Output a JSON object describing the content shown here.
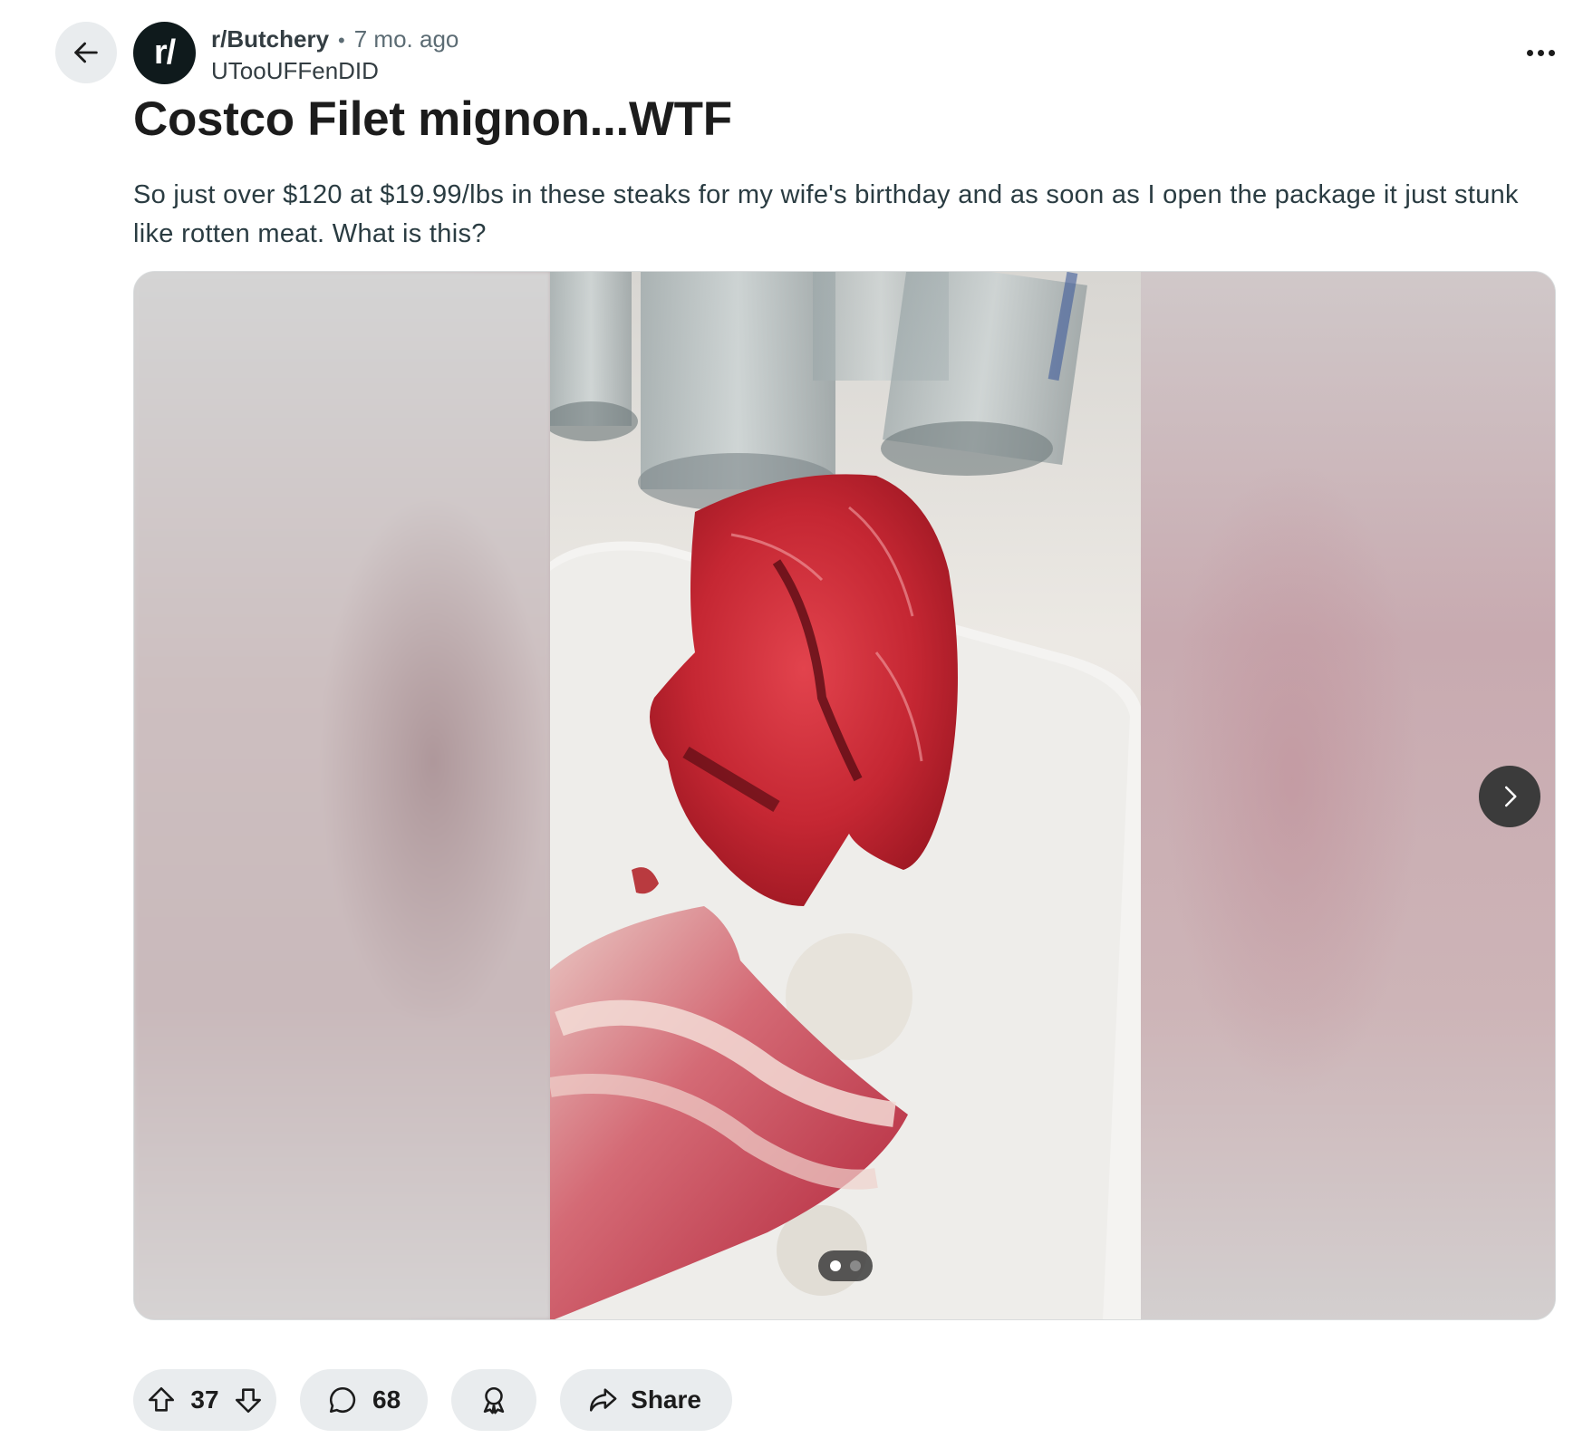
{
  "post": {
    "subreddit": "r/Butchery",
    "subreddit_avatar_text": "r/",
    "separator": "•",
    "time": "7 mo. ago",
    "author": "UTooUFFenDID",
    "title": "Costco Filet mignon...WTF",
    "body": "So just over $120 at $19.99/lbs in these steaks for my wife's birthday and as soon as I open the package it just stunk like rotten meat. What is this?"
  },
  "media": {
    "type": "image-gallery",
    "image_count": 2,
    "current_index": 1
  },
  "actions": {
    "upvotes": "37",
    "comments": "68",
    "share_label": "Share"
  },
  "icons": {
    "back": "arrow-left-icon",
    "more": "ellipsis-icon",
    "next": "chevron-right-icon",
    "upvote": "arrow-up-icon",
    "downvote": "arrow-down-icon",
    "comment": "speech-bubble-icon",
    "award": "award-icon",
    "share": "share-arrow-icon"
  }
}
